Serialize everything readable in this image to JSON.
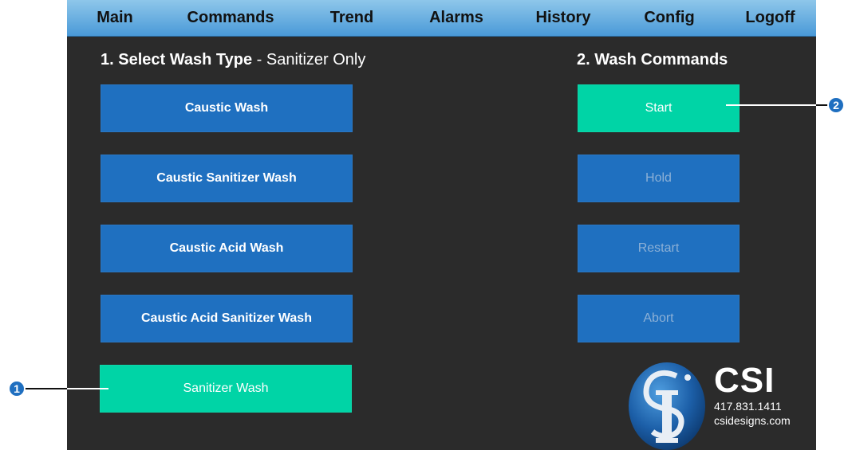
{
  "nav": {
    "items": [
      "Main",
      "Commands",
      "Trend",
      "Alarms",
      "History",
      "Config",
      "Logoff"
    ]
  },
  "wash_type": {
    "heading": "1. Select Wash Type",
    "separator": " - ",
    "selected": "Sanitizer Only",
    "buttons": [
      {
        "label": "Caustic Wash",
        "state": "normal"
      },
      {
        "label": "Caustic Sanitizer Wash",
        "state": "normal"
      },
      {
        "label": "Caustic Acid Wash",
        "state": "normal"
      },
      {
        "label": "Caustic Acid Sanitizer Wash",
        "state": "normal"
      },
      {
        "label": "Sanitizer Wash",
        "state": "active"
      }
    ]
  },
  "wash_commands": {
    "heading": "2. Wash Commands",
    "buttons": [
      {
        "label": "Start",
        "state": "active"
      },
      {
        "label": "Hold",
        "state": "disabled"
      },
      {
        "label": "Restart",
        "state": "disabled"
      },
      {
        "label": "Abort",
        "state": "disabled"
      }
    ]
  },
  "callouts": [
    "1",
    "2"
  ],
  "logo": {
    "name": "CSI",
    "phone": "417.831.1411",
    "website": "csidesigns.com",
    "icon": "csi-logo-icon"
  },
  "colors": {
    "panel": "#2b2b2b",
    "button_blue": "#1f70c0",
    "button_active": "#00d4a6",
    "nav_gradient_top": "#8ec7ea",
    "nav_gradient_bottom": "#4a9ad8"
  }
}
